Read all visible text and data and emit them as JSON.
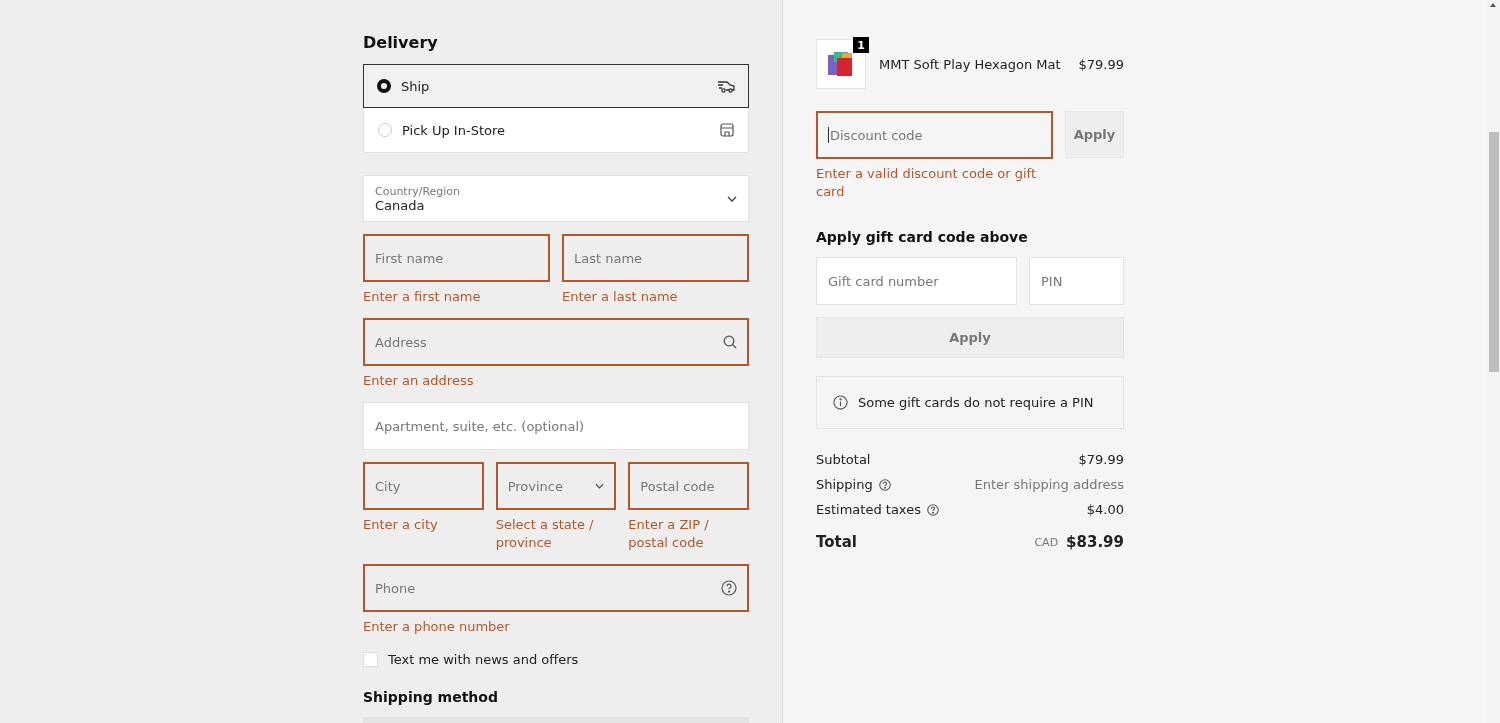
{
  "delivery": {
    "title": "Delivery",
    "options": [
      {
        "label": "Ship",
        "selected": true,
        "kind": "truck"
      },
      {
        "label": "Pick Up In-Store",
        "selected": false,
        "kind": "store"
      }
    ]
  },
  "country": {
    "label": "Country/Region",
    "value": "Canada"
  },
  "field_rows": [
    [
      {
        "placeholder": "First name",
        "error": "Enter a first name",
        "kind": "text"
      },
      {
        "placeholder": "Last name",
        "error": "Enter a last name",
        "kind": "text"
      }
    ],
    [
      {
        "placeholder": "Address",
        "error": "Enter an address",
        "kind": "search"
      }
    ],
    [
      {
        "placeholder": "Apartment, suite, etc. (optional)",
        "kind": "text"
      }
    ],
    [
      {
        "placeholder": "City",
        "error": "Enter a city",
        "kind": "text"
      },
      {
        "placeholder": "Province",
        "error": "Select a state / province",
        "kind": "select"
      },
      {
        "placeholder": "Postal code",
        "error": "Enter a ZIP / postal code",
        "kind": "text"
      }
    ],
    [
      {
        "placeholder": "Phone",
        "error": "Enter a phone number",
        "kind": "help"
      }
    ]
  ],
  "sms_opt_in": {
    "label": "Text me with news and offers",
    "checked": false
  },
  "shipping_method": {
    "title": "Shipping method"
  },
  "cart": {
    "items": [
      {
        "name": "MMT Soft Play Hexagon Mat",
        "price": "$79.99",
        "quantity": "1"
      }
    ]
  },
  "discount": {
    "placeholder": "Discount code",
    "error": "Enter a valid discount code or gift card",
    "button": "Apply"
  },
  "gift_card": {
    "title": "Apply gift card code above",
    "number_placeholder": "Gift card number",
    "pin_placeholder": "PIN",
    "button": "Apply",
    "note": "Some gift cards do not require a PIN"
  },
  "summary": {
    "rows": [
      {
        "label": "Subtotal",
        "value": "$79.99",
        "help": false,
        "muted": false
      },
      {
        "label": "Shipping",
        "value": "Enter shipping address",
        "help": true,
        "muted": true
      },
      {
        "label": "Estimated taxes",
        "value": "$4.00",
        "help": true,
        "muted": false
      }
    ],
    "total": {
      "label": "Total",
      "currency": "CAD",
      "value": "$83.99"
    }
  }
}
